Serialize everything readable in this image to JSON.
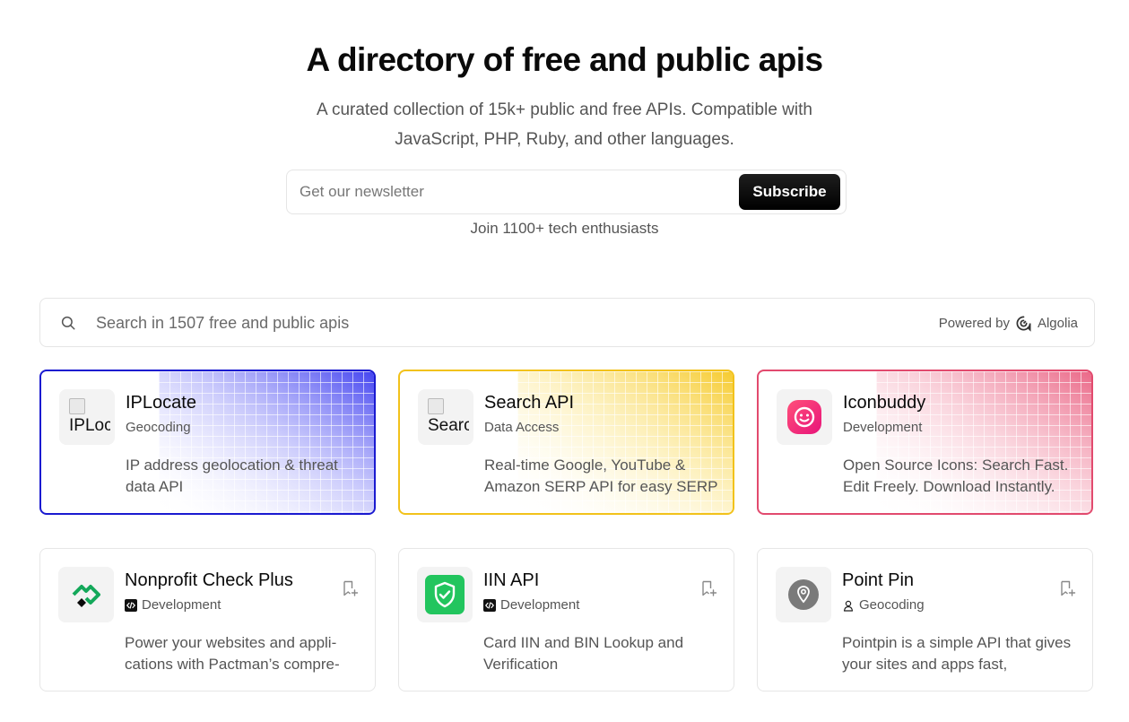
{
  "hero": {
    "title": "A directory of free and public apis",
    "subtitle_line1": "A curated collection of 15k+ public and free APIs. Compatible with",
    "subtitle_line2": "JavaScript, PHP, Ruby, and other languages."
  },
  "newsletter": {
    "placeholder": "Get our newsletter",
    "button_label": "Subscribe",
    "join_text": "Join 1100+ tech enthusiasts"
  },
  "search": {
    "placeholder": "Search in 1507 free and public apis",
    "powered_by": "Powered by",
    "provider": "Algolia"
  },
  "cards": [
    {
      "title": "IPLocate",
      "category": "Geocoding",
      "desc": "IP address geolocation & threat data API",
      "logo_alt": "IPLocate",
      "accent": "#1a1ad0"
    },
    {
      "title": "Search API",
      "category": "Data Access",
      "desc": "Real-time Google, YouTube & Amazon SERP API for easy SERP",
      "logo_alt": "Search API",
      "accent": "#f2c21b"
    },
    {
      "title": "Iconbuddy",
      "category": "Development",
      "desc": "Open Source Icons: Search Fast. Edit Freely. Download Instantly.",
      "accent": "#e24a6e"
    },
    {
      "title": "Nonprofit Check Plus",
      "category": "Development",
      "desc": "Power your websites and appli­cations with Pactman’s compre-",
      "category_icon": "code-icon"
    },
    {
      "title": "IIN API",
      "category": "Development",
      "desc": "Card IIN and BIN Lookup and Verification",
      "category_icon": "code-icon"
    },
    {
      "title": "Point Pin",
      "category": "Geocoding",
      "desc": "Pointpin is a simple API that gives your sites and apps fast,",
      "category_icon": "person-pin-icon"
    }
  ]
}
